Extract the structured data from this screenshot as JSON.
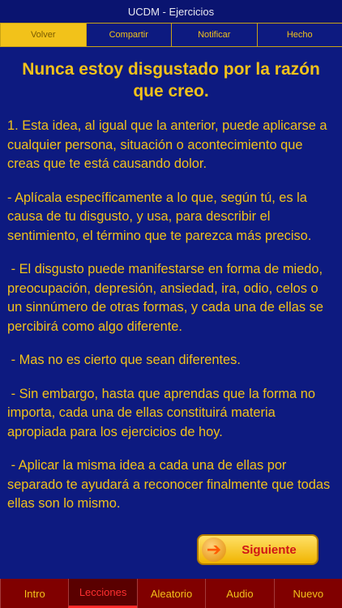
{
  "app": {
    "title": "UCDM - Ejercicios"
  },
  "top_nav": [
    {
      "label": "Volver",
      "active": true
    },
    {
      "label": "Compartir",
      "active": false
    },
    {
      "label": "Notificar",
      "active": false
    },
    {
      "label": "Hecho",
      "active": false
    }
  ],
  "lesson": {
    "title": "Nunca estoy disgustado por la razón que creo.",
    "paragraphs": [
      "1. Esta idea, al igual que la anterior, puede aplicarse a cualquier persona, situación o acontecimiento que creas que te está causando dolor.",
      "- Aplícala específicamente a lo que, según tú, es la causa de tu disgusto, y usa, para describir el sentimiento, el término que te parezca más preciso.",
      " - El disgusto puede manifestarse en forma de miedo, preocupación, depresión, ansiedad, ira, odio, celos o un sinnúmero de otras formas, y cada una de ellas se percibirá como algo diferente.",
      " - Mas no es cierto que sean diferentes.",
      " - Sin embargo, hasta que aprendas que la forma no importa, cada una de ellas constituirá materia apropiada para los ejercicios de hoy.",
      " - Aplicar la misma idea a cada una de ellas por separado te ayudará a reconocer finalmente que todas ellas son lo mismo."
    ]
  },
  "next_button": {
    "label": "Siguiente",
    "icon": "arrow-right-icon"
  },
  "bottom_nav": [
    {
      "label": "Intro",
      "active": false
    },
    {
      "label": "Lecciones",
      "active": true
    },
    {
      "label": "Aleatorio",
      "active": false
    },
    {
      "label": "Audio",
      "active": false
    },
    {
      "label": "Nuevo",
      "active": false
    }
  ],
  "colors": {
    "background": "#0d1a80",
    "accent": "#f2c21a",
    "bottom_bar": "#800000",
    "active_red": "#ff2a2a"
  }
}
